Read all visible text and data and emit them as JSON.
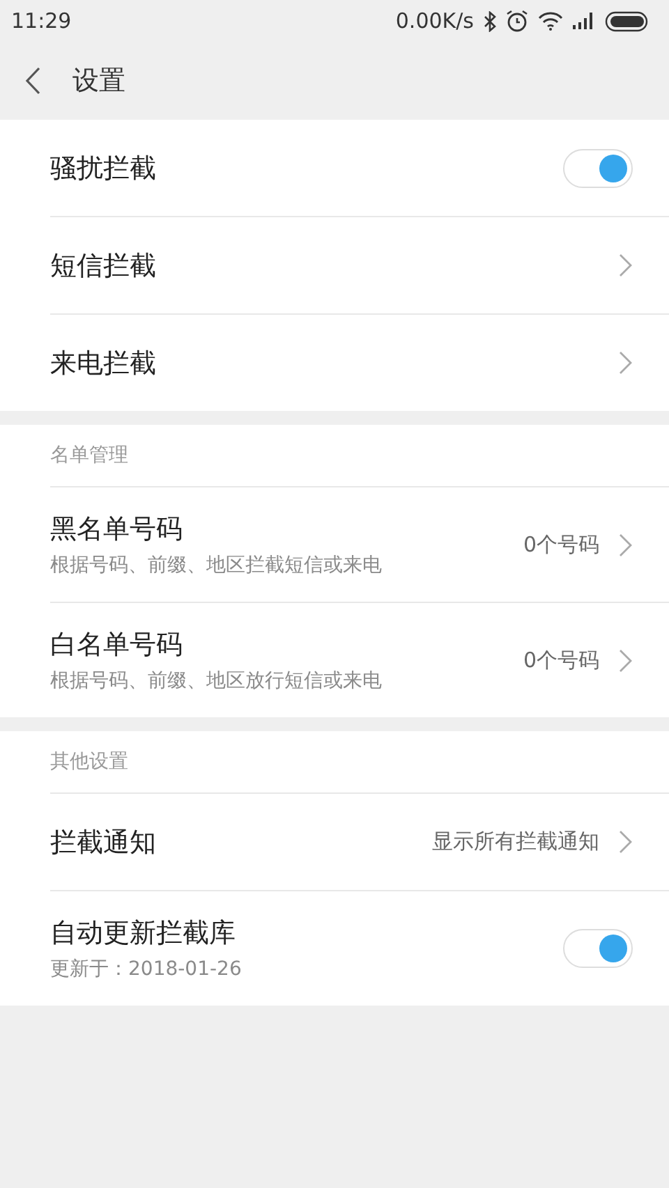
{
  "status_bar": {
    "time": "11:29",
    "speed": "0.00K/s"
  },
  "header": {
    "title": "设置"
  },
  "sections": [
    {
      "rows": [
        {
          "kind": "toggle",
          "title": "骚扰拦截",
          "on": true
        },
        {
          "kind": "link",
          "title": "短信拦截"
        },
        {
          "kind": "link",
          "title": "来电拦截"
        }
      ]
    },
    {
      "header": "名单管理",
      "rows": [
        {
          "kind": "link",
          "title": "黑名单号码",
          "subtitle": "根据号码、前缀、地区拦截短信或来电",
          "value": "0个号码"
        },
        {
          "kind": "link",
          "title": "白名单号码",
          "subtitle": "根据号码、前缀、地区放行短信或来电",
          "value": "0个号码"
        }
      ]
    },
    {
      "header": "其他设置",
      "rows": [
        {
          "kind": "link",
          "title": "拦截通知",
          "value": "显示所有拦截通知"
        },
        {
          "kind": "toggle",
          "title": "自动更新拦截库",
          "subtitle": "更新于：2018-01-26",
          "on": true
        }
      ]
    }
  ]
}
